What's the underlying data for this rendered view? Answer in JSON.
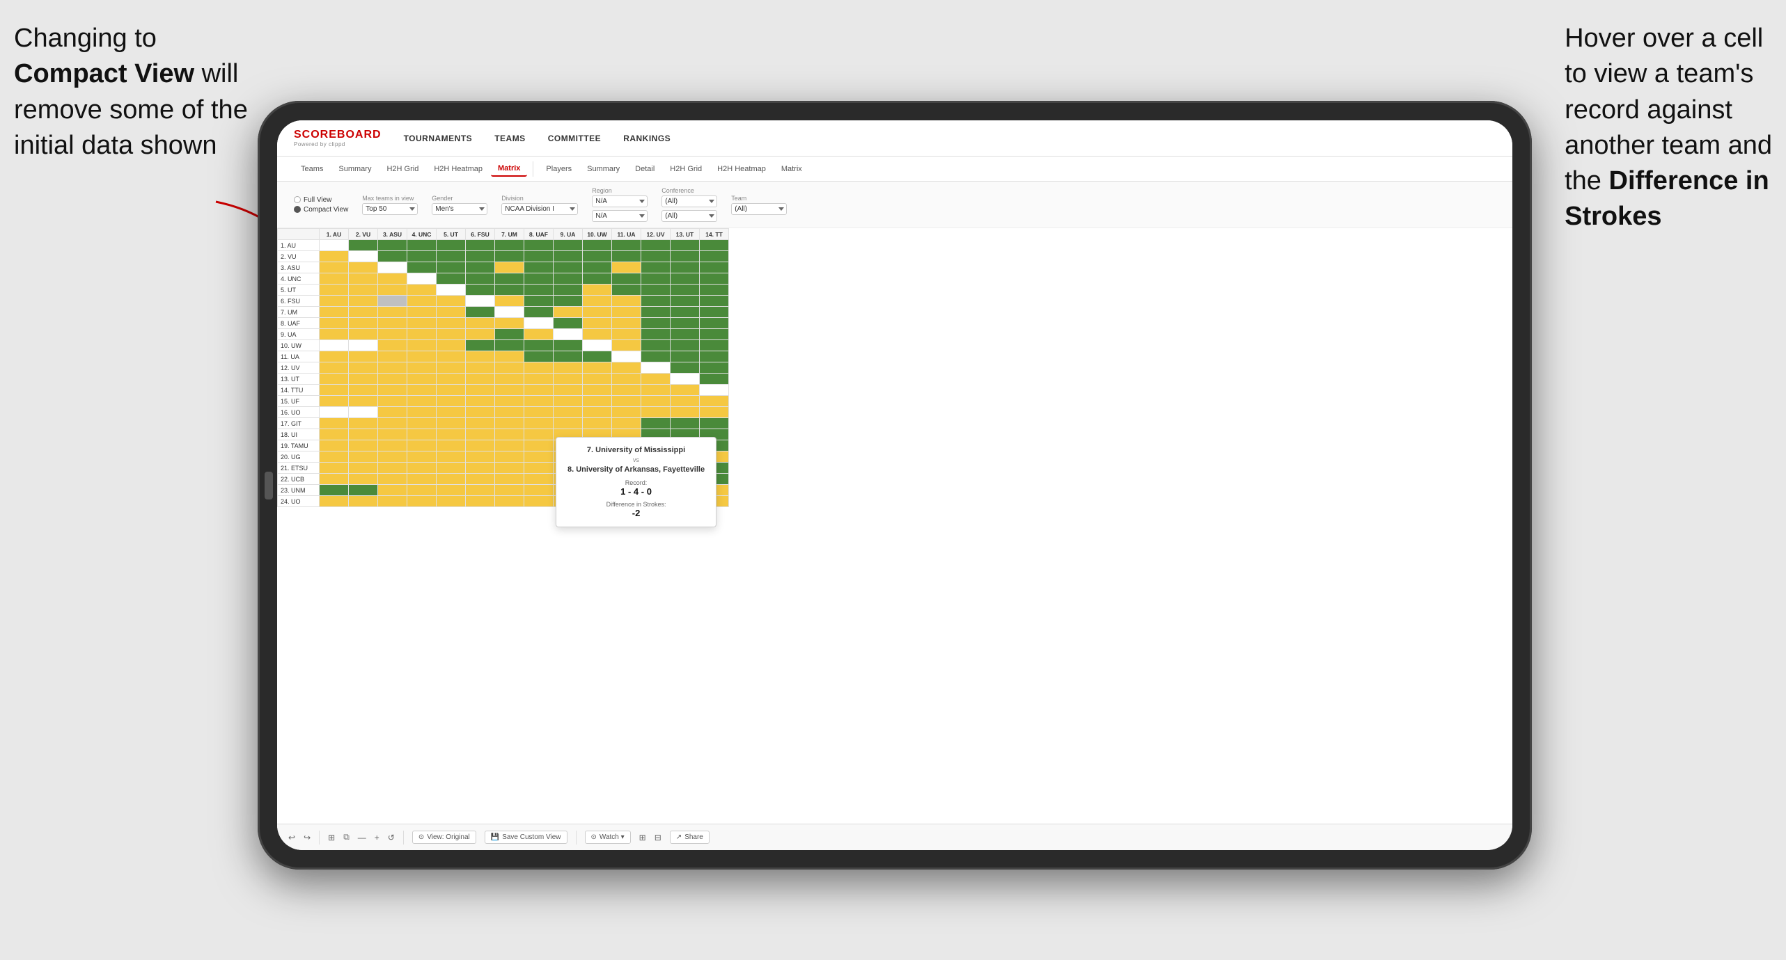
{
  "annotations": {
    "left": {
      "line1": "Changing to",
      "line2bold": "Compact View",
      "line2rest": " will",
      "line3": "remove some of the",
      "line4": "initial data shown"
    },
    "right": {
      "line1": "Hover over a cell",
      "line2": "to view a team's",
      "line3": "record against",
      "line4": "another team and",
      "line5start": "the ",
      "line5bold": "Difference in",
      "line6bold": "Strokes"
    }
  },
  "app": {
    "logo": "SCOREBOARD",
    "logo_sub": "Powered by clippd",
    "nav": [
      "TOURNAMENTS",
      "TEAMS",
      "COMMITTEE",
      "RANKINGS"
    ]
  },
  "sub_tabs_left": [
    "Teams",
    "Summary",
    "H2H Grid",
    "H2H Heatmap",
    "Matrix"
  ],
  "sub_tabs_right": [
    "Players",
    "Summary",
    "Detail",
    "H2H Grid",
    "H2H Heatmap",
    "Matrix"
  ],
  "filters": {
    "view_options": [
      "Full View",
      "Compact View"
    ],
    "selected_view": "Compact View",
    "max_teams": {
      "label": "Max teams in view",
      "value": "Top 50"
    },
    "gender": {
      "label": "Gender",
      "value": "Men's"
    },
    "division": {
      "label": "Division",
      "value": "NCAA Division I"
    },
    "region": {
      "label": "Region",
      "value": "N/A",
      "value2": "N/A"
    },
    "conference": {
      "label": "Conference",
      "value": "(All)",
      "value2": "(All)"
    },
    "team": {
      "label": "Team",
      "value": "(All)"
    }
  },
  "col_headers": [
    "1. AU",
    "2. VU",
    "3. ASU",
    "4. UNC",
    "5. UT",
    "6. FSU",
    "7. UM",
    "8. UAF",
    "9. UA",
    "10. UW",
    "11. UA",
    "12. UV",
    "13. UT",
    "14. TT"
  ],
  "row_teams": [
    "1. AU",
    "2. VU",
    "3. ASU",
    "4. UNC",
    "5. UT",
    "6. FSU",
    "7. UM",
    "8. UAF",
    "9. UA",
    "10. UW",
    "11. UA",
    "12. UV",
    "13. UT",
    "14. TTU",
    "15. UF",
    "16. UO",
    "17. GIT",
    "18. UI",
    "19. TAMU",
    "20. UG",
    "21. ETSU",
    "22. UCB",
    "23. UNM",
    "24. UO"
  ],
  "tooltip": {
    "team1": "7. University of Mississippi",
    "vs": "vs",
    "team2": "8. University of Arkansas, Fayetteville",
    "record_label": "Record:",
    "record_value": "1 - 4 - 0",
    "diff_label": "Difference in Strokes:",
    "diff_value": "-2"
  },
  "toolbar": {
    "view_original": "⊙ View: Original",
    "save_custom": "💾 Save Custom View",
    "watch": "⊙ Watch ▾",
    "share": "Share"
  }
}
